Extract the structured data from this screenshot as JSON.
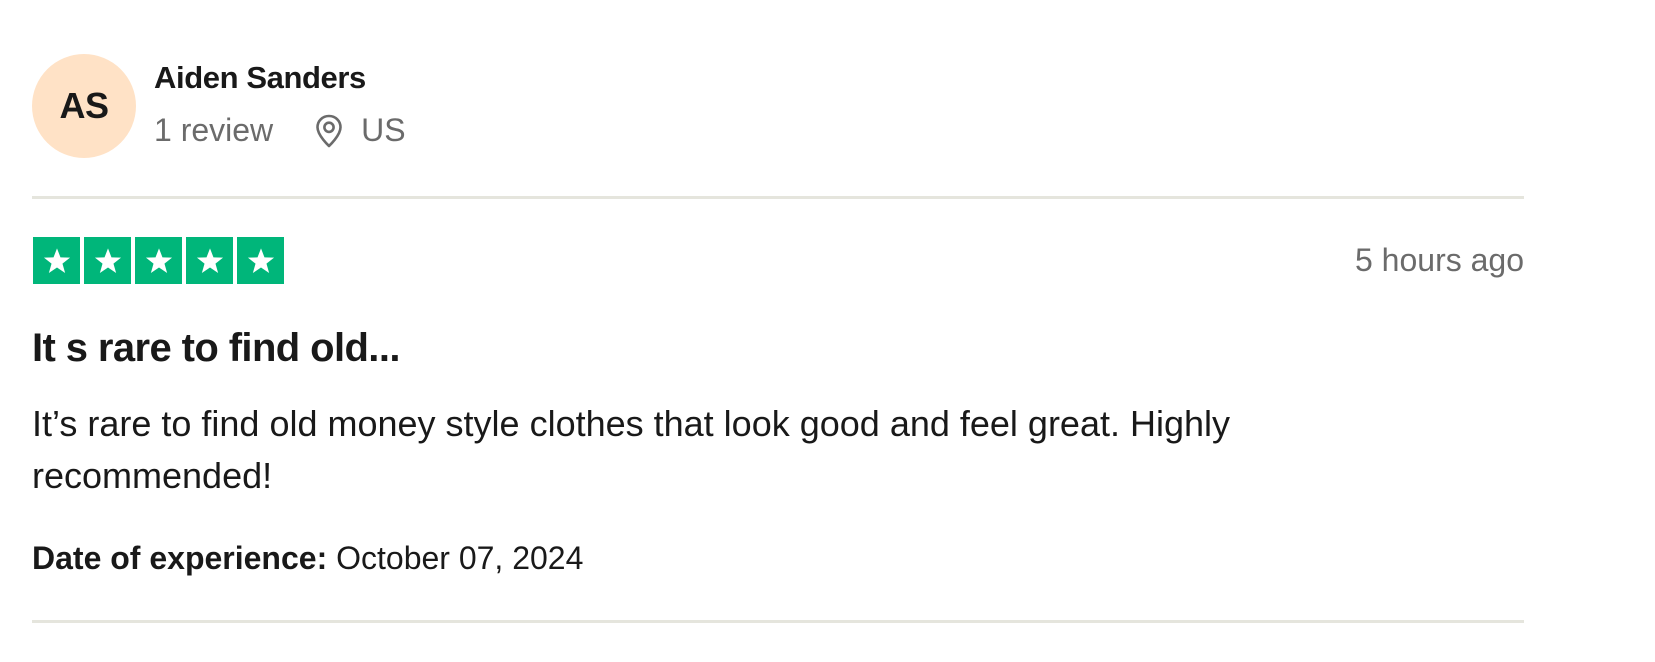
{
  "reviewer": {
    "initials": "AS",
    "name": "Aiden Sanders",
    "review_count": "1 review",
    "country": "US",
    "avatar_color": "#ffe2c6"
  },
  "review": {
    "rating": 5,
    "rating_max": 5,
    "star_color": "#00b67a",
    "time_ago": "5 hours ago",
    "title": "It s rare to find old...",
    "body": "It’s rare to find old money style clothes that look good and feel great. Highly recommended!",
    "experience_label": "Date of experience:",
    "experience_date": "October 07, 2024"
  },
  "icons": {
    "location": "location-pin-icon",
    "star": "star-icon"
  }
}
